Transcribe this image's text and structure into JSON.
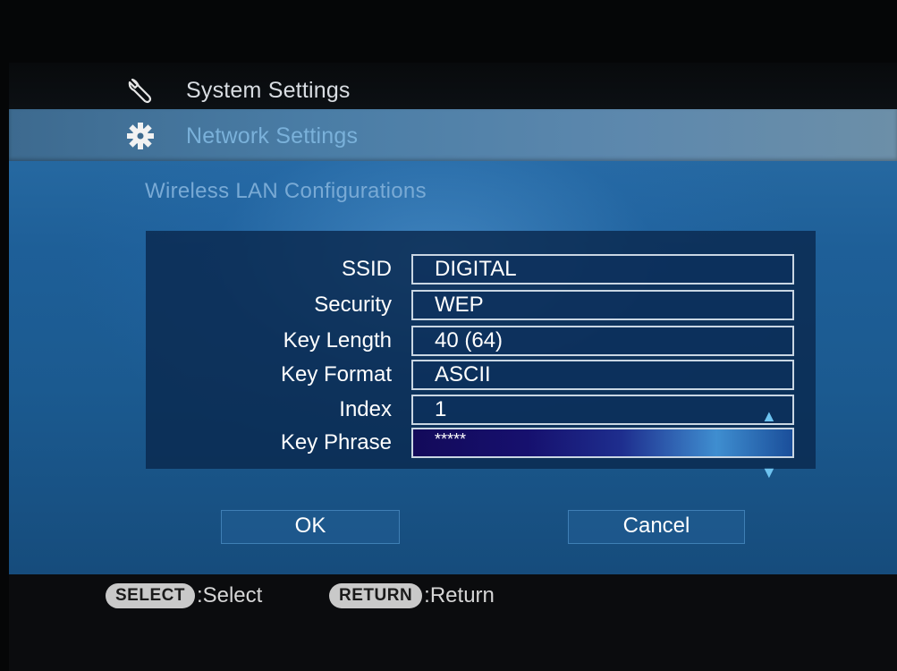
{
  "menu": {
    "system_settings": "System Settings",
    "network_settings": "Network Settings"
  },
  "section_title": "Wireless LAN Configurations",
  "fields": [
    {
      "label": "SSID",
      "value": "DIGITAL"
    },
    {
      "label": "Security",
      "value": "WEP"
    },
    {
      "label": "Key Length",
      "value": "40 (64)"
    },
    {
      "label": "Key Format",
      "value": "ASCII"
    },
    {
      "label": "Index",
      "value": "1"
    },
    {
      "label": "Key Phrase",
      "value": "*****"
    }
  ],
  "buttons": {
    "ok": "OK",
    "cancel": "Cancel"
  },
  "hints": [
    {
      "key": "SELECT",
      "text": ":Select"
    },
    {
      "key": "RETURN",
      "text": ":Return"
    }
  ],
  "icons": {
    "system": "wrench-icon",
    "network": "gear-icon",
    "up": "arrow-up-icon",
    "down": "arrow-down-icon"
  },
  "colors": {
    "panel_blue": "#1e5f98",
    "selected_band": "#4a7da6",
    "form_box": "#0a284e",
    "active_field": "#16106e",
    "section_title": "#79aad5",
    "arrow": "#6ec3f0"
  }
}
